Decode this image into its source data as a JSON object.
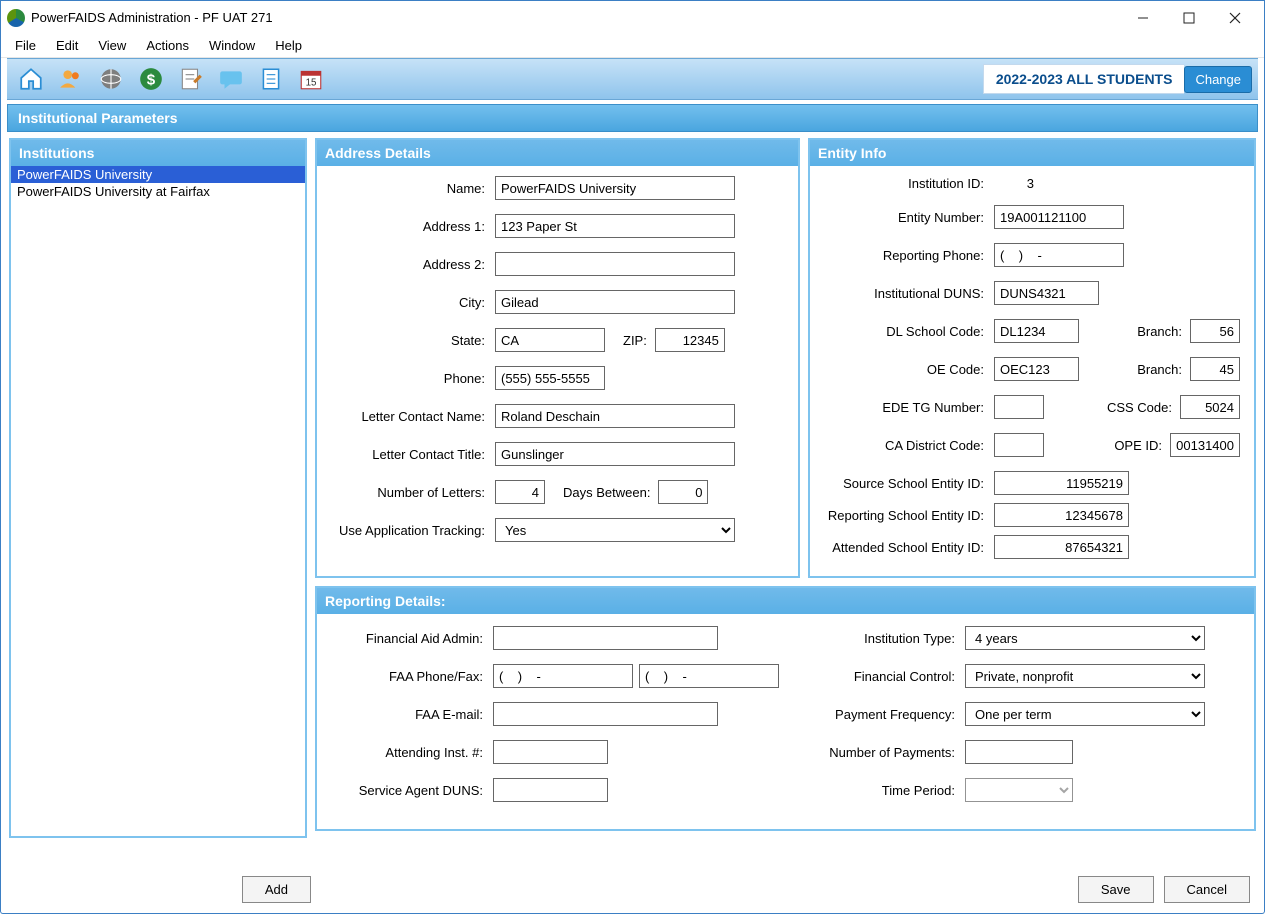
{
  "window": {
    "title": "PowerFAIDS Administration - PF UAT 271"
  },
  "menu": {
    "items": [
      "File",
      "Edit",
      "View",
      "Actions",
      "Window",
      "Help"
    ]
  },
  "toolbar": {
    "year_label": "2022-2023 ALL STUDENTS",
    "change_label": "Change",
    "icons": [
      "home",
      "people",
      "globe",
      "money",
      "form",
      "chat",
      "document",
      "calendar"
    ]
  },
  "page_header": "Institutional Parameters",
  "institutions": {
    "header": "Institutions",
    "items": [
      "PowerFAIDS University",
      "PowerFAIDS University at Fairfax"
    ],
    "selected_index": 0
  },
  "address": {
    "header": "Address Details",
    "name_label": "Name:",
    "name": "PowerFAIDS University",
    "addr1_label": "Address 1:",
    "addr1": "123 Paper St",
    "addr2_label": "Address 2:",
    "addr2": "",
    "city_label": "City:",
    "city": "Gilead",
    "state_label": "State:",
    "state": "CA",
    "zip_label": "ZIP:",
    "zip": "12345",
    "phone_label": "Phone:",
    "phone": "(555) 555-5555",
    "lcname_label": "Letter Contact Name:",
    "lcname": "Roland Deschain",
    "lctitle_label": "Letter Contact Title:",
    "lctitle": "Gunslinger",
    "numletters_label": "Number of Letters:",
    "numletters": "4",
    "daysbetween_label": "Days Between:",
    "daysbetween": "0",
    "apptrack_label": "Use Application Tracking:",
    "apptrack_value": "Yes"
  },
  "entity": {
    "header": "Entity Info",
    "instid_label": "Institution ID:",
    "instid": "3",
    "entitynum_label": "Entity Number:",
    "entitynum": "19A001121100",
    "repphone_label": "Reporting Phone:",
    "repphone": "(    )    -",
    "duns_label": "Institutional DUNS:",
    "duns": "DUNS4321",
    "dlcode_label": "DL School Code:",
    "dlcode": "DL1234",
    "branch1_label": "Branch:",
    "branch1": "56",
    "oecode_label": "OE Code:",
    "oecode": "OEC123",
    "branch2_label": "Branch:",
    "branch2": "45",
    "edetg_label": "EDE TG Number:",
    "edetg": "",
    "csscode_label": "CSS Code:",
    "csscode": "5024",
    "cadistrict_label": "CA District Code:",
    "cadistrict": "",
    "opeid_label": "OPE ID:",
    "opeid": "00131400",
    "srcschool_label": "Source School Entity ID:",
    "srcschool": "11955219",
    "repschool_label": "Reporting School Entity ID:",
    "repschool": "12345678",
    "attschool_label": "Attended School Entity ID:",
    "attschool": "87654321"
  },
  "reporting": {
    "header": "Reporting Details:",
    "faadmin_label": "Financial Aid Admin:",
    "faadmin": "",
    "faaphone_label": "FAA Phone/Fax:",
    "faaphone": "(    )    -",
    "faafax": "(    )    -",
    "faaemail_label": "FAA E-mail:",
    "faaemail": "",
    "attinst_label": "Attending Inst. #:",
    "attinst": "",
    "svcagentduns_label": "Service Agent DUNS:",
    "svcagentduns": "",
    "insttype_label": "Institution Type:",
    "insttype": "4 years",
    "fincontrol_label": "Financial Control:",
    "fincontrol": "Private, nonprofit",
    "payfreq_label": "Payment Frequency:",
    "payfreq": "One per term",
    "numpay_label": "Number of Payments:",
    "numpay": "",
    "timeperiod_label": "Time Period:",
    "timeperiod": ""
  },
  "buttons": {
    "add": "Add",
    "save": "Save",
    "cancel": "Cancel"
  }
}
